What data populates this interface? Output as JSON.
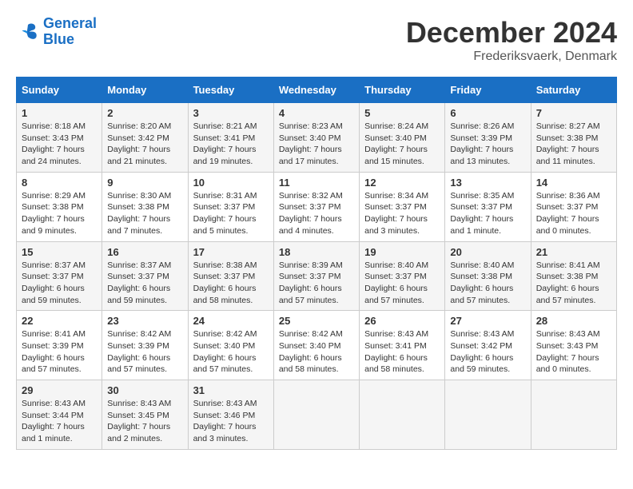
{
  "header": {
    "logo_line1": "General",
    "logo_line2": "Blue",
    "month": "December 2024",
    "location": "Frederiksvaerk, Denmark"
  },
  "weekdays": [
    "Sunday",
    "Monday",
    "Tuesday",
    "Wednesday",
    "Thursday",
    "Friday",
    "Saturday"
  ],
  "weeks": [
    [
      {
        "day": "1",
        "info": "Sunrise: 8:18 AM\nSunset: 3:43 PM\nDaylight: 7 hours\nand 24 minutes."
      },
      {
        "day": "2",
        "info": "Sunrise: 8:20 AM\nSunset: 3:42 PM\nDaylight: 7 hours\nand 21 minutes."
      },
      {
        "day": "3",
        "info": "Sunrise: 8:21 AM\nSunset: 3:41 PM\nDaylight: 7 hours\nand 19 minutes."
      },
      {
        "day": "4",
        "info": "Sunrise: 8:23 AM\nSunset: 3:40 PM\nDaylight: 7 hours\nand 17 minutes."
      },
      {
        "day": "5",
        "info": "Sunrise: 8:24 AM\nSunset: 3:40 PM\nDaylight: 7 hours\nand 15 minutes."
      },
      {
        "day": "6",
        "info": "Sunrise: 8:26 AM\nSunset: 3:39 PM\nDaylight: 7 hours\nand 13 minutes."
      },
      {
        "day": "7",
        "info": "Sunrise: 8:27 AM\nSunset: 3:38 PM\nDaylight: 7 hours\nand 11 minutes."
      }
    ],
    [
      {
        "day": "8",
        "info": "Sunrise: 8:29 AM\nSunset: 3:38 PM\nDaylight: 7 hours\nand 9 minutes."
      },
      {
        "day": "9",
        "info": "Sunrise: 8:30 AM\nSunset: 3:38 PM\nDaylight: 7 hours\nand 7 minutes."
      },
      {
        "day": "10",
        "info": "Sunrise: 8:31 AM\nSunset: 3:37 PM\nDaylight: 7 hours\nand 5 minutes."
      },
      {
        "day": "11",
        "info": "Sunrise: 8:32 AM\nSunset: 3:37 PM\nDaylight: 7 hours\nand 4 minutes."
      },
      {
        "day": "12",
        "info": "Sunrise: 8:34 AM\nSunset: 3:37 PM\nDaylight: 7 hours\nand 3 minutes."
      },
      {
        "day": "13",
        "info": "Sunrise: 8:35 AM\nSunset: 3:37 PM\nDaylight: 7 hours\nand 1 minute."
      },
      {
        "day": "14",
        "info": "Sunrise: 8:36 AM\nSunset: 3:37 PM\nDaylight: 7 hours\nand 0 minutes."
      }
    ],
    [
      {
        "day": "15",
        "info": "Sunrise: 8:37 AM\nSunset: 3:37 PM\nDaylight: 6 hours\nand 59 minutes."
      },
      {
        "day": "16",
        "info": "Sunrise: 8:37 AM\nSunset: 3:37 PM\nDaylight: 6 hours\nand 59 minutes."
      },
      {
        "day": "17",
        "info": "Sunrise: 8:38 AM\nSunset: 3:37 PM\nDaylight: 6 hours\nand 58 minutes."
      },
      {
        "day": "18",
        "info": "Sunrise: 8:39 AM\nSunset: 3:37 PM\nDaylight: 6 hours\nand 57 minutes."
      },
      {
        "day": "19",
        "info": "Sunrise: 8:40 AM\nSunset: 3:37 PM\nDaylight: 6 hours\nand 57 minutes."
      },
      {
        "day": "20",
        "info": "Sunrise: 8:40 AM\nSunset: 3:38 PM\nDaylight: 6 hours\nand 57 minutes."
      },
      {
        "day": "21",
        "info": "Sunrise: 8:41 AM\nSunset: 3:38 PM\nDaylight: 6 hours\nand 57 minutes."
      }
    ],
    [
      {
        "day": "22",
        "info": "Sunrise: 8:41 AM\nSunset: 3:39 PM\nDaylight: 6 hours\nand 57 minutes."
      },
      {
        "day": "23",
        "info": "Sunrise: 8:42 AM\nSunset: 3:39 PM\nDaylight: 6 hours\nand 57 minutes."
      },
      {
        "day": "24",
        "info": "Sunrise: 8:42 AM\nSunset: 3:40 PM\nDaylight: 6 hours\nand 57 minutes."
      },
      {
        "day": "25",
        "info": "Sunrise: 8:42 AM\nSunset: 3:40 PM\nDaylight: 6 hours\nand 58 minutes."
      },
      {
        "day": "26",
        "info": "Sunrise: 8:43 AM\nSunset: 3:41 PM\nDaylight: 6 hours\nand 58 minutes."
      },
      {
        "day": "27",
        "info": "Sunrise: 8:43 AM\nSunset: 3:42 PM\nDaylight: 6 hours\nand 59 minutes."
      },
      {
        "day": "28",
        "info": "Sunrise: 8:43 AM\nSunset: 3:43 PM\nDaylight: 7 hours\nand 0 minutes."
      }
    ],
    [
      {
        "day": "29",
        "info": "Sunrise: 8:43 AM\nSunset: 3:44 PM\nDaylight: 7 hours\nand 1 minute."
      },
      {
        "day": "30",
        "info": "Sunrise: 8:43 AM\nSunset: 3:45 PM\nDaylight: 7 hours\nand 2 minutes."
      },
      {
        "day": "31",
        "info": "Sunrise: 8:43 AM\nSunset: 3:46 PM\nDaylight: 7 hours\nand 3 minutes."
      },
      null,
      null,
      null,
      null
    ]
  ]
}
